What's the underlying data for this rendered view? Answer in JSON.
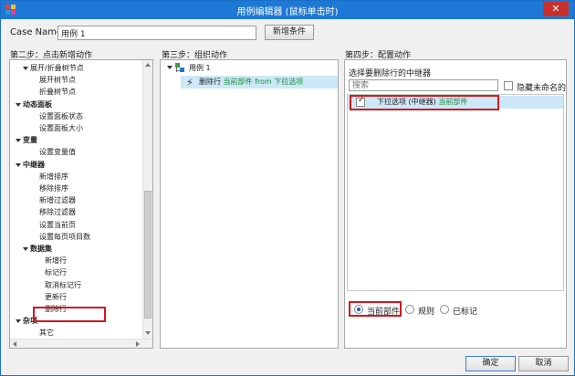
{
  "window": {
    "title": "用例编辑器 (鼠标单击时)",
    "close_label": "✕"
  },
  "case": {
    "label": "Case Name",
    "value": "用例 1",
    "add_condition_label": "新增条件"
  },
  "step2": {
    "heading": "第二步：点击新增动作",
    "items": [
      {
        "label": "展开/折叠树节点",
        "level": 1,
        "expandable": true
      },
      {
        "label": "展开树节点",
        "level": 2
      },
      {
        "label": "折叠树节点",
        "level": 2
      },
      {
        "label": "动态面板",
        "level": 0,
        "expandable": true,
        "bold": true
      },
      {
        "label": "设置面板状态",
        "level": 2
      },
      {
        "label": "设置面板大小",
        "level": 2
      },
      {
        "label": "变量",
        "level": 0,
        "expandable": true,
        "bold": true
      },
      {
        "label": "设置变量值",
        "level": 2
      },
      {
        "label": "中继器",
        "level": 0,
        "expandable": true,
        "bold": true
      },
      {
        "label": "新增排序",
        "level": 2
      },
      {
        "label": "移除排序",
        "level": 2
      },
      {
        "label": "新增过滤器",
        "level": 2
      },
      {
        "label": "移除过滤器",
        "level": 2
      },
      {
        "label": "设置当前页",
        "level": 2
      },
      {
        "label": "设置每页项目数",
        "level": 2
      },
      {
        "label": "数据集",
        "level": 1,
        "expandable": true,
        "bold": true
      },
      {
        "label": "新增行",
        "level": 3
      },
      {
        "label": "标记行",
        "level": 3
      },
      {
        "label": "取消标记行",
        "level": 3
      },
      {
        "label": "更新行",
        "level": 3
      },
      {
        "label": "删除行",
        "level": 3,
        "highlighted": true
      },
      {
        "label": "杂项",
        "level": 0,
        "expandable": true,
        "bold": true
      },
      {
        "label": "其它",
        "level": 2
      }
    ]
  },
  "step3": {
    "heading": "第三步：组织动作",
    "case_label": "用例 1",
    "action_label": "删除行",
    "action_detail": "当前部件 from 下拉选项"
  },
  "step4": {
    "heading": "第四步：配置动作",
    "subheading": "选择要删除行的中继器",
    "search_placeholder": "搜索",
    "hide_unnamed_label": "隐藏未命名的",
    "repeater_item": {
      "name": "下拉选项 (中继器)",
      "detail": "当前部件",
      "checked": true
    },
    "radio_options": [
      {
        "label": "当前部件",
        "selected": true
      },
      {
        "label": "规则",
        "selected": false
      },
      {
        "label": "已标记",
        "selected": false
      }
    ]
  },
  "footer": {
    "ok_label": "确定",
    "cancel_label": "取消"
  },
  "colors": {
    "accent": "#1e78d6",
    "highlight_box": "#d0191f",
    "selection": "#cde8f7",
    "link_text": "#1a8a3a"
  }
}
